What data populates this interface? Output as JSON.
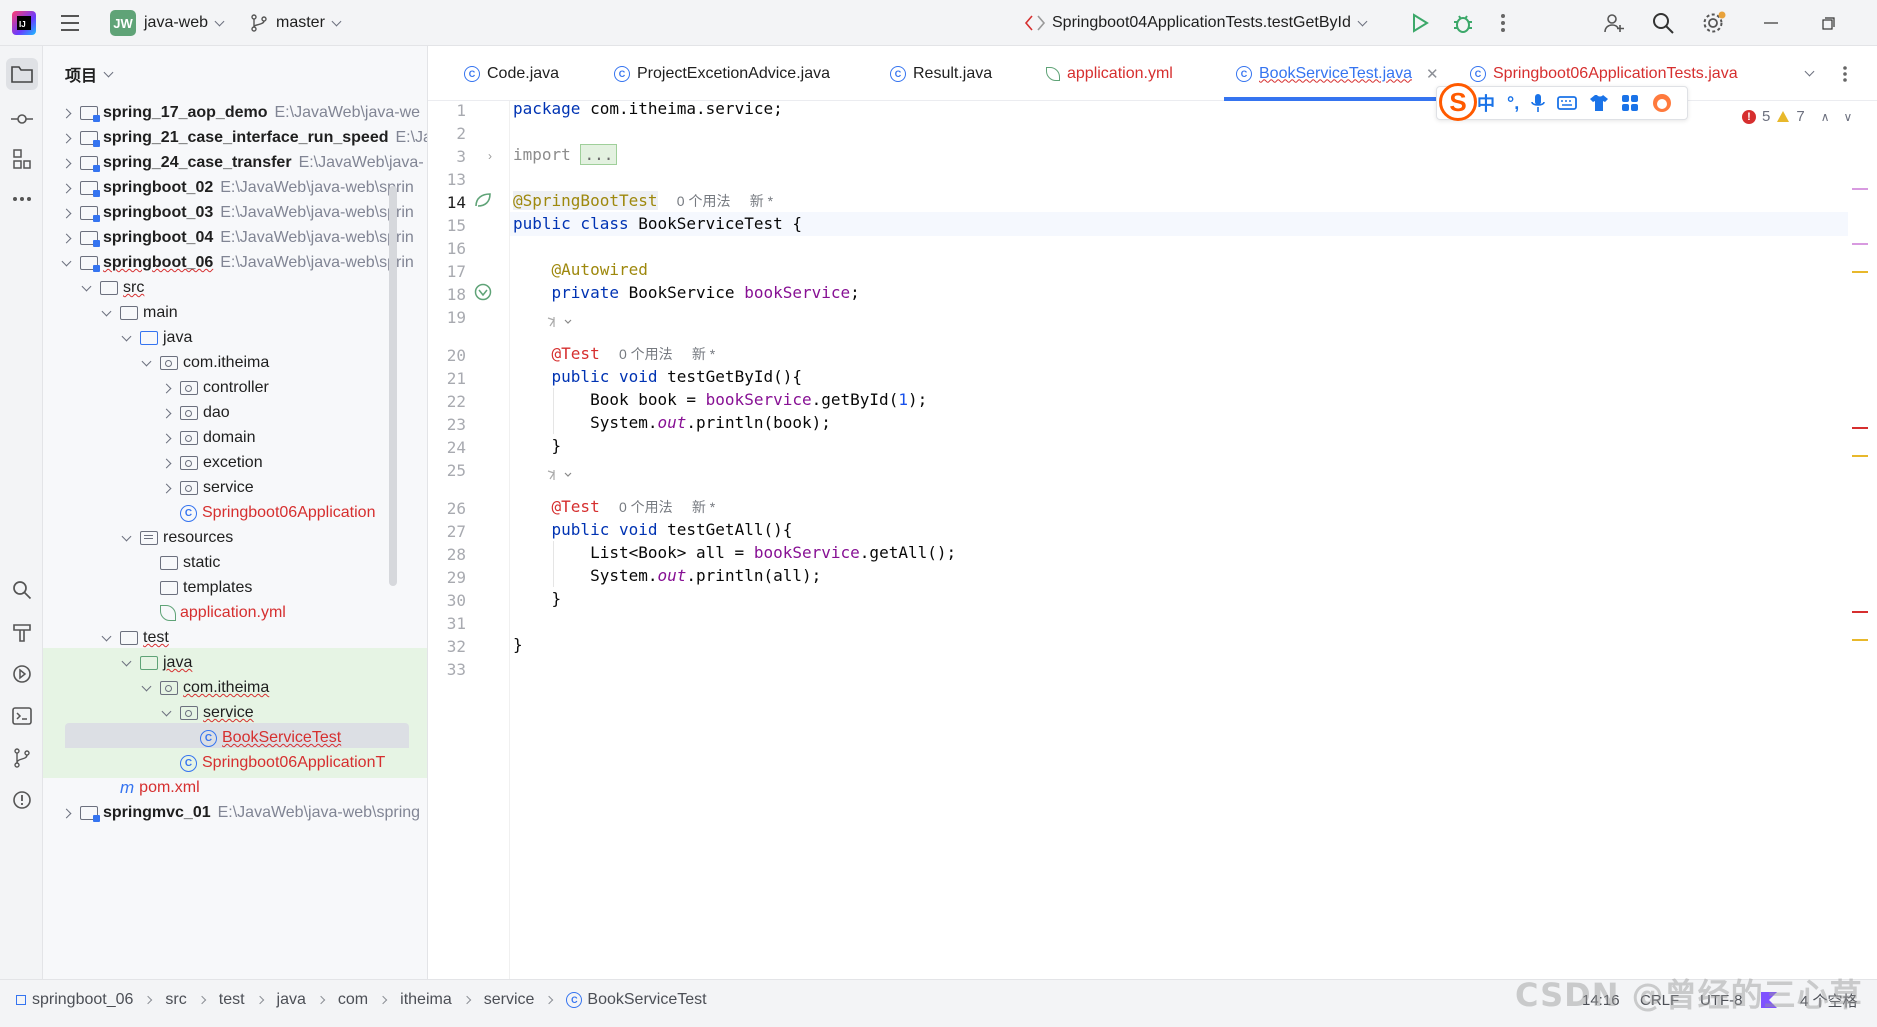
{
  "titlebar": {
    "project_badge": "JW",
    "project_name": "java-web",
    "branch": "master",
    "run_config": "Springboot04ApplicationTests.testGetById"
  },
  "project_panel": {
    "title": "项目",
    "tree": [
      {
        "label": "spring_17_aop_demo",
        "path": "E:\\JavaWeb\\java-we",
        "kind": "module",
        "bold": true
      },
      {
        "label": "spring_21_case_interface_run_speed",
        "path": "E:\\Ja",
        "kind": "module",
        "bold": true
      },
      {
        "label": "spring_24_case_transfer",
        "path": "E:\\JavaWeb\\java-",
        "kind": "module",
        "bold": true
      },
      {
        "label": "springboot_02",
        "path": "E:\\JavaWeb\\java-web\\sprin",
        "kind": "module",
        "bold": true
      },
      {
        "label": "springboot_03",
        "path": "E:\\JavaWeb\\java-web\\sprin",
        "kind": "module",
        "bold": true
      },
      {
        "label": "springboot_04",
        "path": "E:\\JavaWeb\\java-web\\sprin",
        "kind": "module",
        "bold": true
      },
      {
        "label": "springboot_06",
        "path": "E:\\JavaWeb\\java-web\\sprin",
        "kind": "module",
        "bold": true
      },
      {
        "label": "src",
        "kind": "folder"
      },
      {
        "label": "main",
        "kind": "folder"
      },
      {
        "label": "java",
        "kind": "folder"
      },
      {
        "label": "com.itheima",
        "kind": "package"
      },
      {
        "label": "controller",
        "kind": "package"
      },
      {
        "label": "dao",
        "kind": "package"
      },
      {
        "label": "domain",
        "kind": "package"
      },
      {
        "label": "excetion",
        "kind": "package"
      },
      {
        "label": "service",
        "kind": "package"
      },
      {
        "label": "Springboot06Application",
        "kind": "class"
      },
      {
        "label": "resources",
        "kind": "resources"
      },
      {
        "label": "static",
        "kind": "folder"
      },
      {
        "label": "templates",
        "kind": "folder"
      },
      {
        "label": "application.yml",
        "kind": "yml"
      },
      {
        "label": "test",
        "kind": "folder"
      },
      {
        "label": "java",
        "kind": "folder"
      },
      {
        "label": "com.itheima",
        "kind": "package"
      },
      {
        "label": "service",
        "kind": "package"
      },
      {
        "label": "BookServiceTest",
        "kind": "class"
      },
      {
        "label": "Springboot06ApplicationT",
        "kind": "class"
      },
      {
        "label": "pom.xml",
        "kind": "maven"
      },
      {
        "label": "springmvc_01",
        "path": "E:\\JavaWeb\\java-web\\spring",
        "kind": "module",
        "bold": true
      }
    ]
  },
  "tabs": [
    {
      "label": "Code.java"
    },
    {
      "label": "ProjectExcetionAdvice.java"
    },
    {
      "label": "Result.java"
    },
    {
      "label": "application.yml"
    },
    {
      "label": "BookServiceTest.java"
    },
    {
      "label": "Springboot06ApplicationTests.java"
    }
  ],
  "editor": {
    "line_numbers": [
      "1",
      "2",
      "3",
      "13",
      "14",
      "15",
      "16",
      "17",
      "18",
      "19",
      "20",
      "21",
      "22",
      "23",
      "24",
      "25",
      "26",
      "27",
      "28",
      "29",
      "30",
      "31",
      "32",
      "33"
    ],
    "usage_hint": "0 个用法",
    "new_hint": "新 *",
    "errors": "5",
    "warnings": "7",
    "code": {
      "l1_kw": "package",
      "l1_rest": " com.itheima.service;",
      "l3_kw": "import",
      "l3_fold": "...",
      "l14_an": "@SpringBootTest",
      "l15_kw": "public class",
      "l15_rest": " BookServiceTest {",
      "l17_an": "@Autowired",
      "l18_kw": "private",
      "l18_type": " BookService ",
      "l18_field": "bookService",
      "l18_end": ";",
      "l20_an": "@Test",
      "l21_kw": "public void",
      "l21_rest": " testGetById(){",
      "l22_a": "Book book = ",
      "l22_field": "bookService",
      "l22_b": ".getById(",
      "l22_num": "1",
      "l22_c": ");",
      "l23_a": "System.",
      "l23_out": "out",
      "l23_b": ".println(book);",
      "l24": "}",
      "l26_an": "@Test",
      "l27_kw": "public void",
      "l27_rest": " testGetAll(){",
      "l28_a": "List<Book> all = ",
      "l28_field": "bookService",
      "l28_b": ".getAll();",
      "l29_a": "System.",
      "l29_out": "out",
      "l29_b": ".println(all);",
      "l30": "}",
      "l32": "}"
    }
  },
  "ime": {
    "logo": "S",
    "mode": "中"
  },
  "statusbar": {
    "breadcrumbs": [
      "springboot_06",
      "src",
      "test",
      "java",
      "com",
      "itheima",
      "service",
      "BookServiceTest"
    ],
    "position": "14:16",
    "line_sep": "CRLF",
    "encoding": "UTF-8",
    "indent": "4 个空格",
    "watermark": "CSDN @曾经的三心草"
  },
  "colors": {
    "accent": "#3574f0",
    "error": "#d62f2f",
    "warning": "#e8b82b",
    "test_green": "#e6f4e4"
  }
}
